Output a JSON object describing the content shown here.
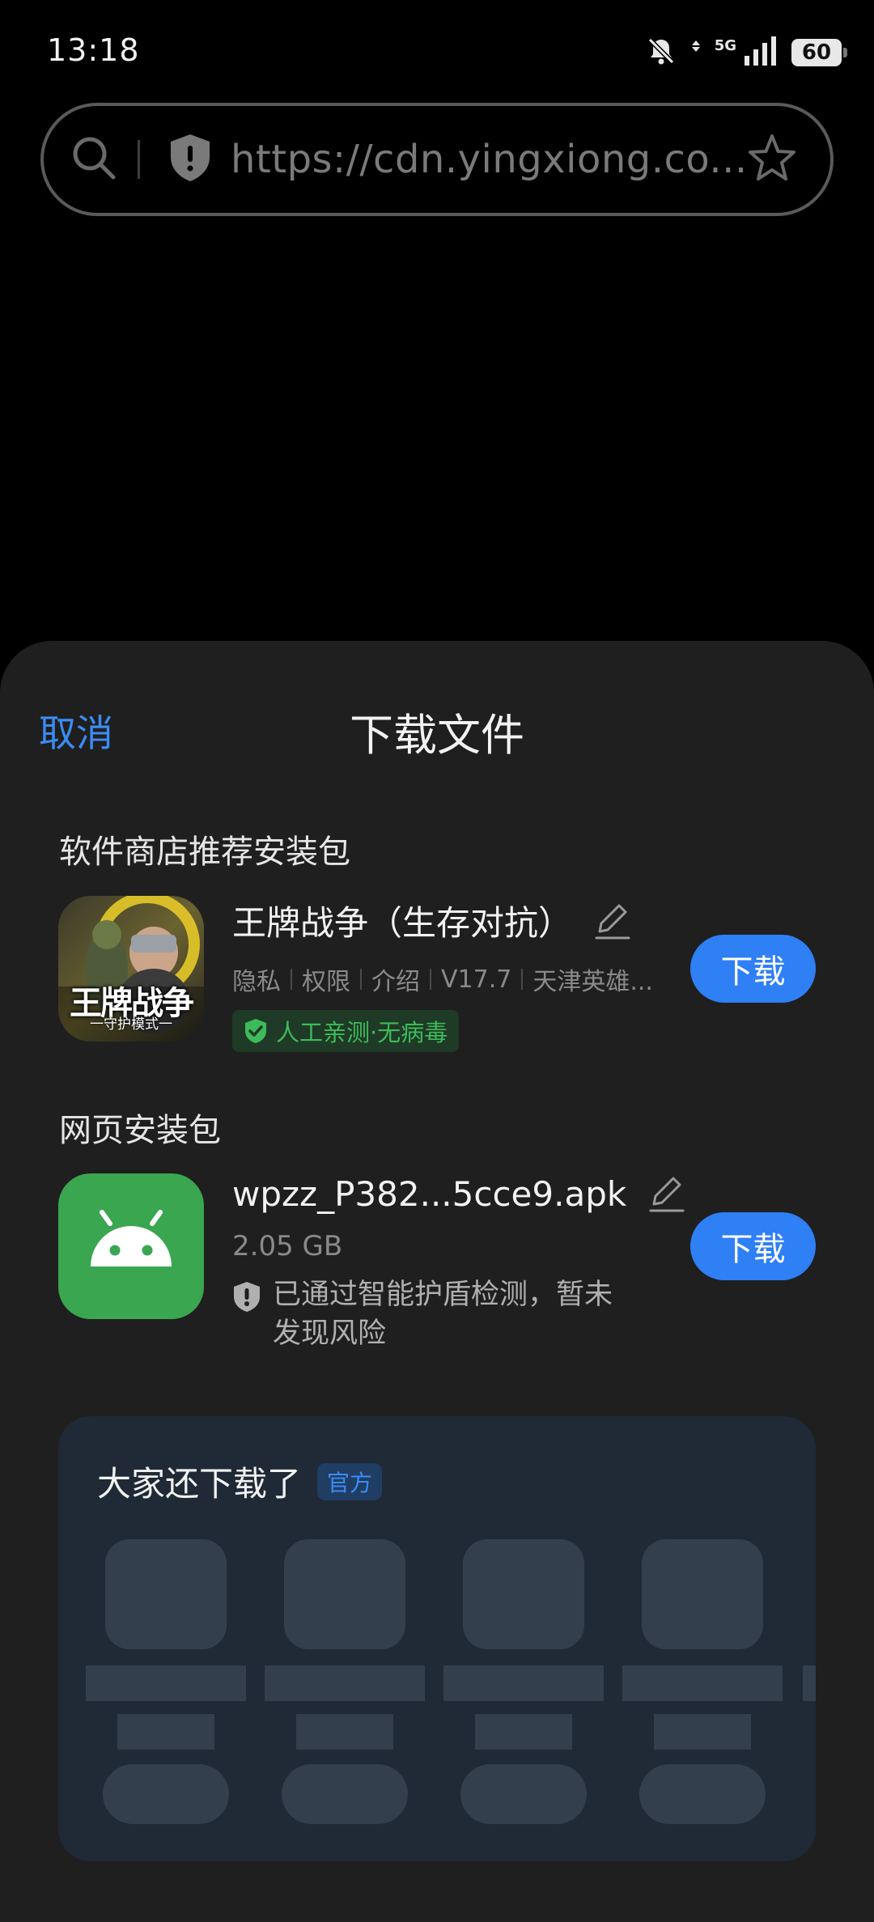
{
  "status_bar": {
    "time": "13:18",
    "network": "5G",
    "battery": "60",
    "icons": [
      "bell-muted-icon",
      "data-arrows-icon",
      "signal-icon",
      "battery-icon"
    ]
  },
  "url_bar": {
    "url": "https://cdn.yingxiong.co...",
    "icons": [
      "search-icon",
      "shield-icon",
      "star-icon"
    ]
  },
  "sheet": {
    "cancel_label": "取消",
    "title": "下载文件",
    "store_section": {
      "title": "软件商店推荐安装包",
      "app": {
        "name": "王牌战争（生存对抗）",
        "meta": [
          "隐私",
          "权限",
          "介绍",
          "V17.7",
          "天津英雄..."
        ],
        "safe_badge": "人工亲测·无病毒",
        "icon_text": "王牌战争",
        "icon_subtext": "一守护模式一",
        "download_label": "下载"
      }
    },
    "web_section": {
      "title": "网页安装包",
      "app": {
        "name": "wpzz_P382...5cce9.apk",
        "size": "2.05 GB",
        "scan_line1": "已通过智能护盾检测，暂未",
        "scan_line2": "发现风险",
        "download_label": "下载"
      }
    },
    "recommend": {
      "title": "大家还下载了",
      "badge": "官方"
    }
  },
  "colors": {
    "accent_blue": "#2f7ff5",
    "link_blue": "#3b8cf5",
    "safe_green": "#3dbb5a",
    "sheet_bg": "#1f1f1f",
    "card_bg": "#1f2a36",
    "android_green": "#3aa650"
  }
}
